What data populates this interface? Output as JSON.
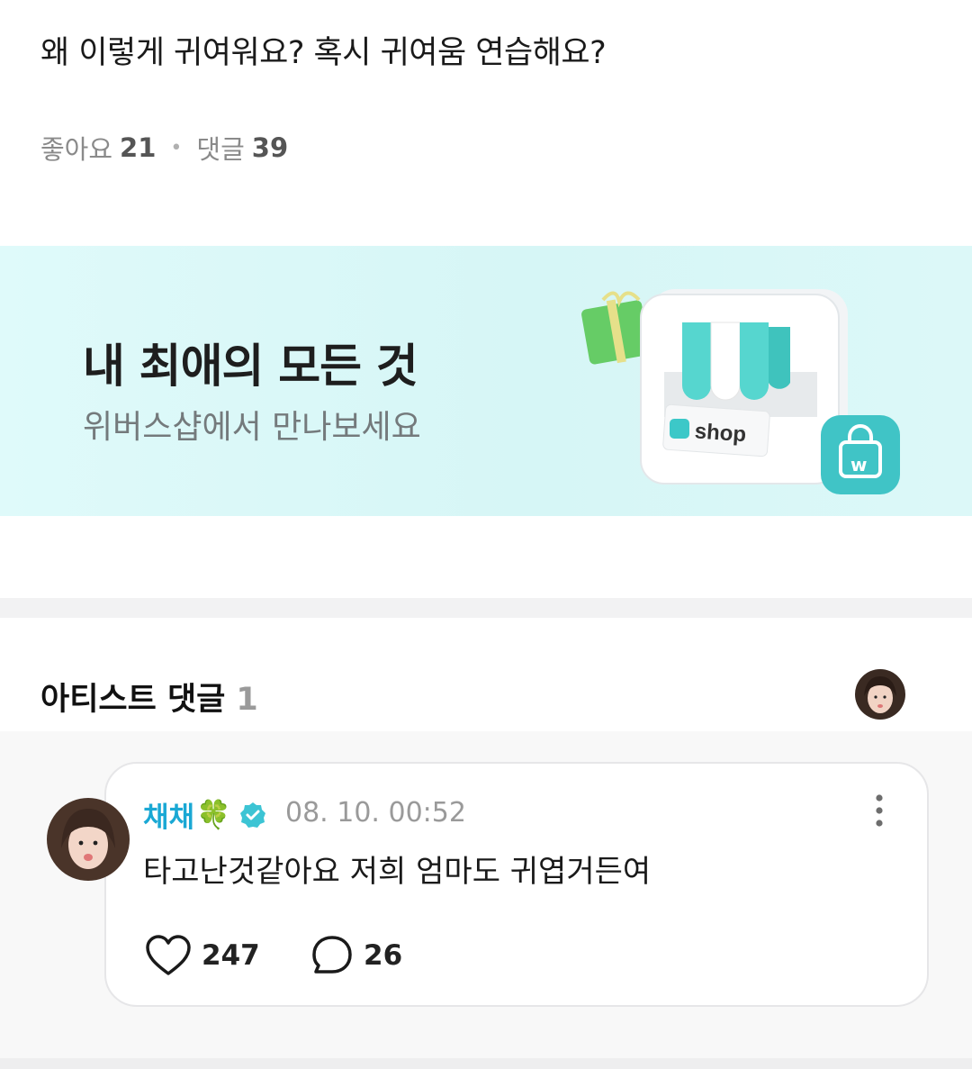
{
  "post": {
    "title": "왜 이렇게 귀여워요? 혹시 귀여움 연습해요?",
    "likes_label": "좋아요",
    "likes_count": "21",
    "comments_label": "댓글",
    "comments_count": "39"
  },
  "banner": {
    "title": "내 최애의 모든 것",
    "subtitle": "위버스샵에서 만나보세요",
    "shop_label": "shop",
    "accent_color": "#3cc8c8"
  },
  "artist_comments": {
    "heading": "아티스트 댓글",
    "count": "1"
  },
  "comment": {
    "author": "채채",
    "author_emoji": "🍀",
    "timestamp": "08. 10. 00:52",
    "text": "타고난것같아요 저희 엄마도 귀엽거든여",
    "likes": "247",
    "replies": "26",
    "author_color": "#1aa8d4"
  }
}
